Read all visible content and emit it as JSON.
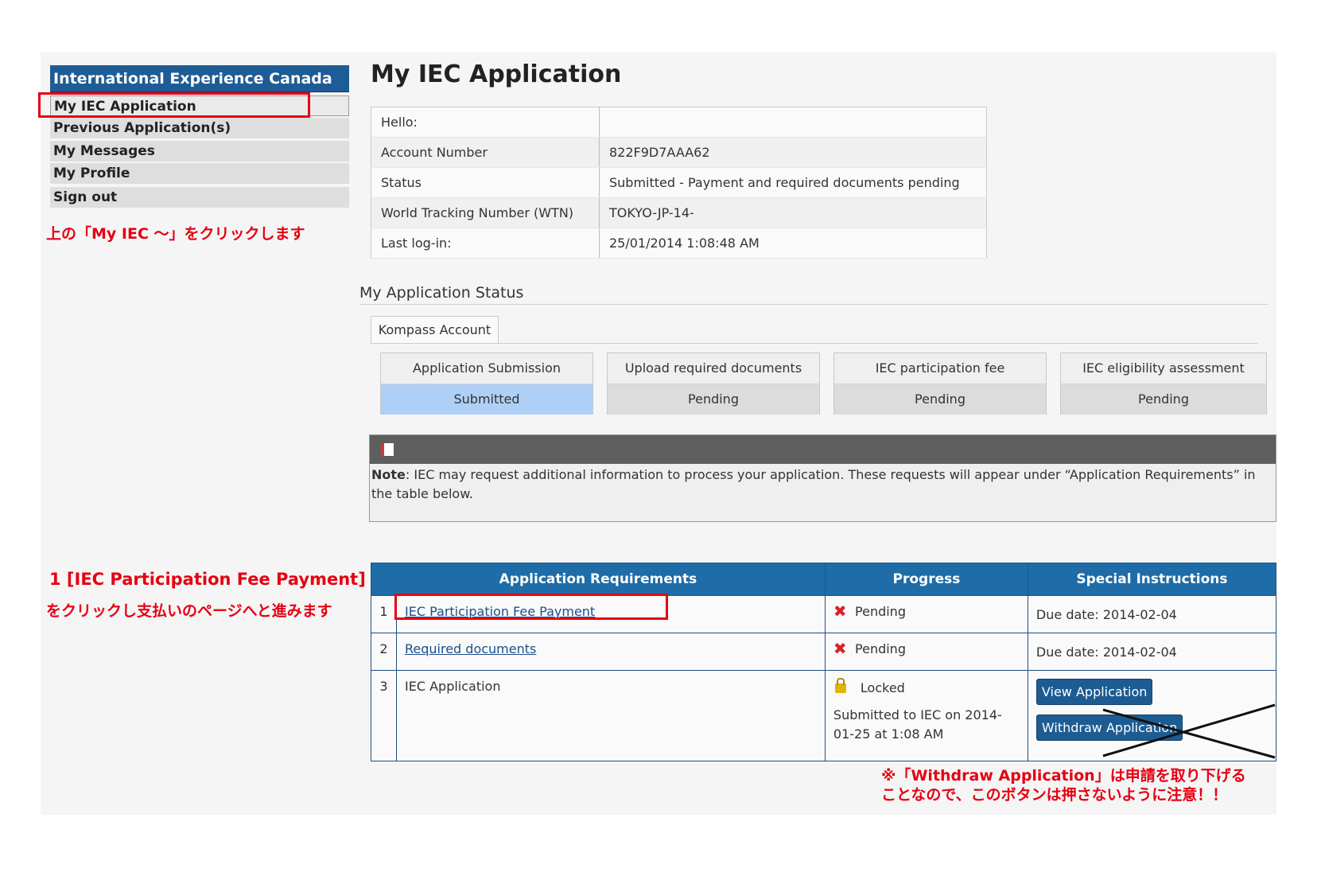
{
  "sidebar": {
    "title": "International Experience Canada",
    "items": [
      {
        "label": "My IEC Application"
      },
      {
        "label": "Previous Application(s)"
      },
      {
        "label": "My Messages"
      },
      {
        "label": "My Profile"
      },
      {
        "label": "Sign out"
      }
    ]
  },
  "annotations": {
    "sidebar_hint": "上の「My IEC ～」をクリックします",
    "fee_hint_line1": "1 [IEC Participation Fee Payment]",
    "fee_hint_line2": "をクリックし支払いのページへと進みます",
    "withdraw_warn_line1": "※「Withdraw Application」は申請を取り下げる",
    "withdraw_warn_line2": "ことなので、このボタンは押さないように注意！！"
  },
  "main": {
    "title": "My IEC Application",
    "info": [
      {
        "key": "Hello:",
        "value": ""
      },
      {
        "key": "Account Number",
        "value": "822F9D7AAA62"
      },
      {
        "key": "Status",
        "value": "Submitted - Payment and required documents pending"
      },
      {
        "key": "World Tracking Number (WTN)",
        "value": "TOKYO-JP-14-"
      },
      {
        "key": "Last log-in:",
        "value": "25/01/2014 1:08:48 AM"
      }
    ],
    "status_section_title": "My Application Status",
    "tab_label": "Kompass Account",
    "steps": [
      {
        "title": "Application Submission",
        "status": "Submitted"
      },
      {
        "title": "Upload required documents",
        "status": "Pending"
      },
      {
        "title": "IEC participation fee",
        "status": "Pending"
      },
      {
        "title": "IEC eligibility assessment",
        "status": "Pending"
      }
    ],
    "note": {
      "label": "Note",
      "text": ": IEC may request additional information to process your application. These requests will appear under “Application Requirements” in the table below."
    }
  },
  "requirements": {
    "headers": [
      "Application Requirements",
      "Progress",
      "Special Instructions"
    ],
    "rows": [
      {
        "num": "1",
        "name": "IEC Participation Fee Payment",
        "progress": "Pending",
        "instructions": "Due date: 2014-02-04"
      },
      {
        "num": "2",
        "name": "Required documents",
        "progress": "Pending",
        "instructions": "Due date: 2014-02-04"
      },
      {
        "num": "3",
        "name": "IEC Application",
        "progress": "Locked",
        "submitted_note": "Submitted to IEC on 2014-01-25 at 1:08 AM",
        "view_button": "View Application",
        "withdraw_button": "Withdraw Application"
      }
    ]
  },
  "colors": {
    "header_blue": "#1e5c96",
    "annotation_red": "#e60012",
    "submitted_blue": "#aed0f6"
  }
}
